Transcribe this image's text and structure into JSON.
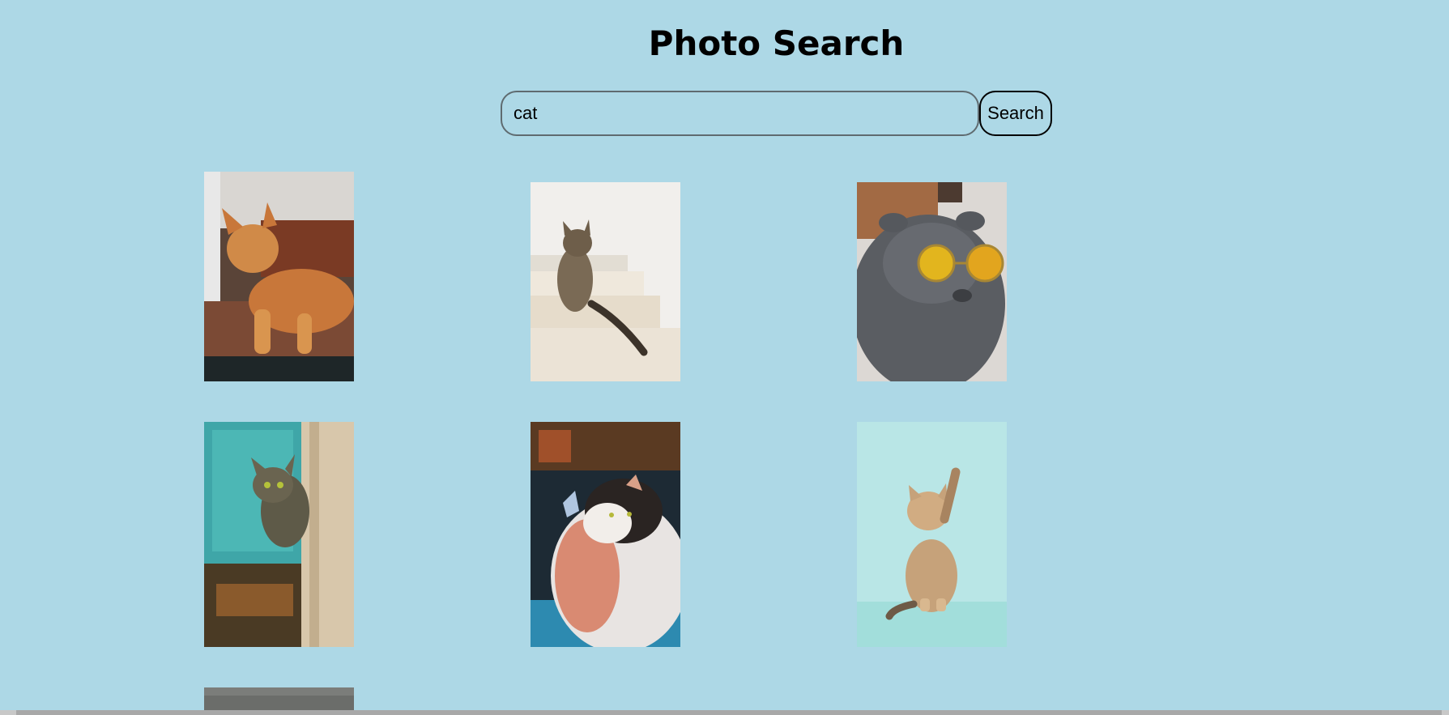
{
  "page": {
    "title": "Photo Search"
  },
  "search": {
    "value": "cat",
    "button_label": "Search"
  },
  "colors": {
    "background": "#add8e6",
    "text": "#000000"
  },
  "results": [
    {
      "alt": "orange long-haired cat lying on a wooden surface"
    },
    {
      "alt": "tabby cat sitting on white stairs"
    },
    {
      "alt": "gray cat wearing yellow round sunglasses"
    },
    {
      "alt": "tabby cat peeking around a wall"
    },
    {
      "alt": "fluffy calico cat with a butterfly"
    },
    {
      "alt": "kitten raising a paw against a teal background"
    },
    {
      "alt": "partially visible photo"
    }
  ]
}
